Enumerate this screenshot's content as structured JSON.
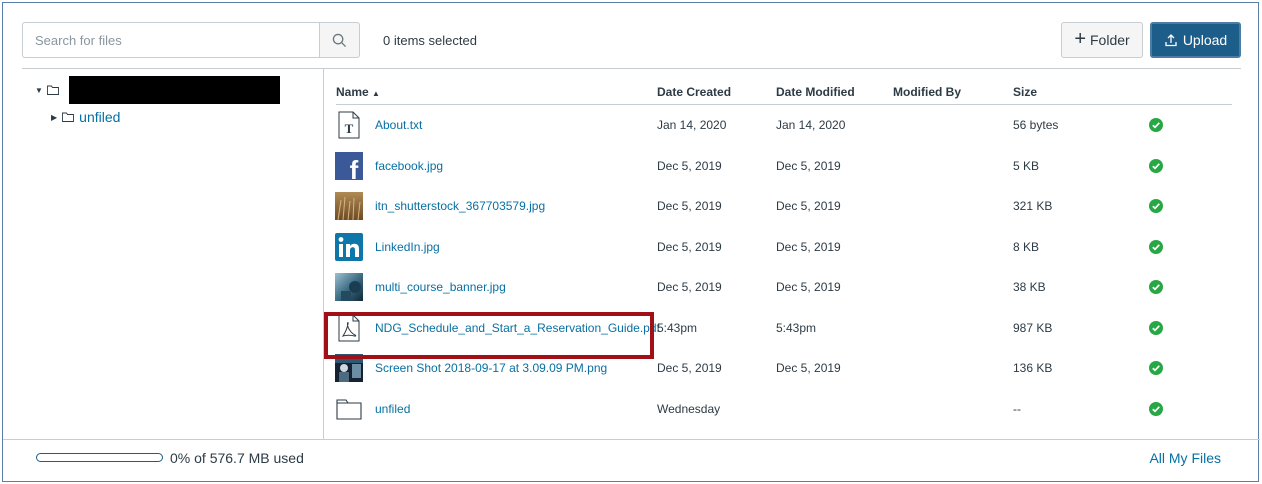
{
  "toolbar": {
    "search_placeholder": "Search for files",
    "search_icon": "search-icon",
    "selected_count": "0 items selected",
    "folder_label": "Folder",
    "upload_label": "Upload"
  },
  "tree": {
    "children": [
      {
        "label": "unfiled"
      }
    ]
  },
  "table": {
    "columns": {
      "name": "Name",
      "sort_indicator": "▲",
      "date_created": "Date Created",
      "date_modified": "Date Modified",
      "modified_by": "Modified By",
      "size": "Size"
    },
    "rows": [
      {
        "name": "About.txt",
        "icon": "text-file-icon",
        "date_created": "Jan 14, 2020",
        "date_modified": "Jan 14, 2020",
        "modified_by": "",
        "size": "56 bytes"
      },
      {
        "name": "facebook.jpg",
        "icon": "facebook-thumbnail-icon",
        "date_created": "Dec 5, 2019",
        "date_modified": "Dec 5, 2019",
        "modified_by": "",
        "size": "5 KB"
      },
      {
        "name": "itn_shutterstock_367703579.jpg",
        "icon": "image-thumbnail-icon",
        "date_created": "Dec 5, 2019",
        "date_modified": "Dec 5, 2019",
        "modified_by": "",
        "size": "321 KB"
      },
      {
        "name": "LinkedIn.jpg",
        "icon": "linkedin-thumbnail-icon",
        "date_created": "Dec 5, 2019",
        "date_modified": "Dec 5, 2019",
        "modified_by": "",
        "size": "8 KB"
      },
      {
        "name": "multi_course_banner.jpg",
        "icon": "image-thumbnail-icon",
        "date_created": "Dec 5, 2019",
        "date_modified": "Dec 5, 2019",
        "modified_by": "",
        "size": "38 KB"
      },
      {
        "name": "NDG_Schedule_and_Start_a_Reservation_Guide.pdf",
        "icon": "pdf-file-icon",
        "date_created": "5:43pm",
        "date_modified": "5:43pm",
        "modified_by": "",
        "size": "987 KB"
      },
      {
        "name": "Screen Shot 2018-09-17 at 3.09.09 PM.png",
        "icon": "image-thumbnail-icon",
        "date_created": "Dec 5, 2019",
        "date_modified": "Dec 5, 2019",
        "modified_by": "",
        "size": "136 KB"
      },
      {
        "name": "unfiled",
        "icon": "folder-icon",
        "date_created": "Wednesday",
        "date_modified": "",
        "modified_by": "",
        "size": "--"
      }
    ]
  },
  "footer": {
    "usage_percent": 0,
    "usage_text": "0% of 576.7 MB used",
    "all_files_label": "All My Files"
  },
  "colors": {
    "link": "#0770a3",
    "primary": "#1d5d8a",
    "published": "#28a745",
    "highlight": "#a11016"
  }
}
